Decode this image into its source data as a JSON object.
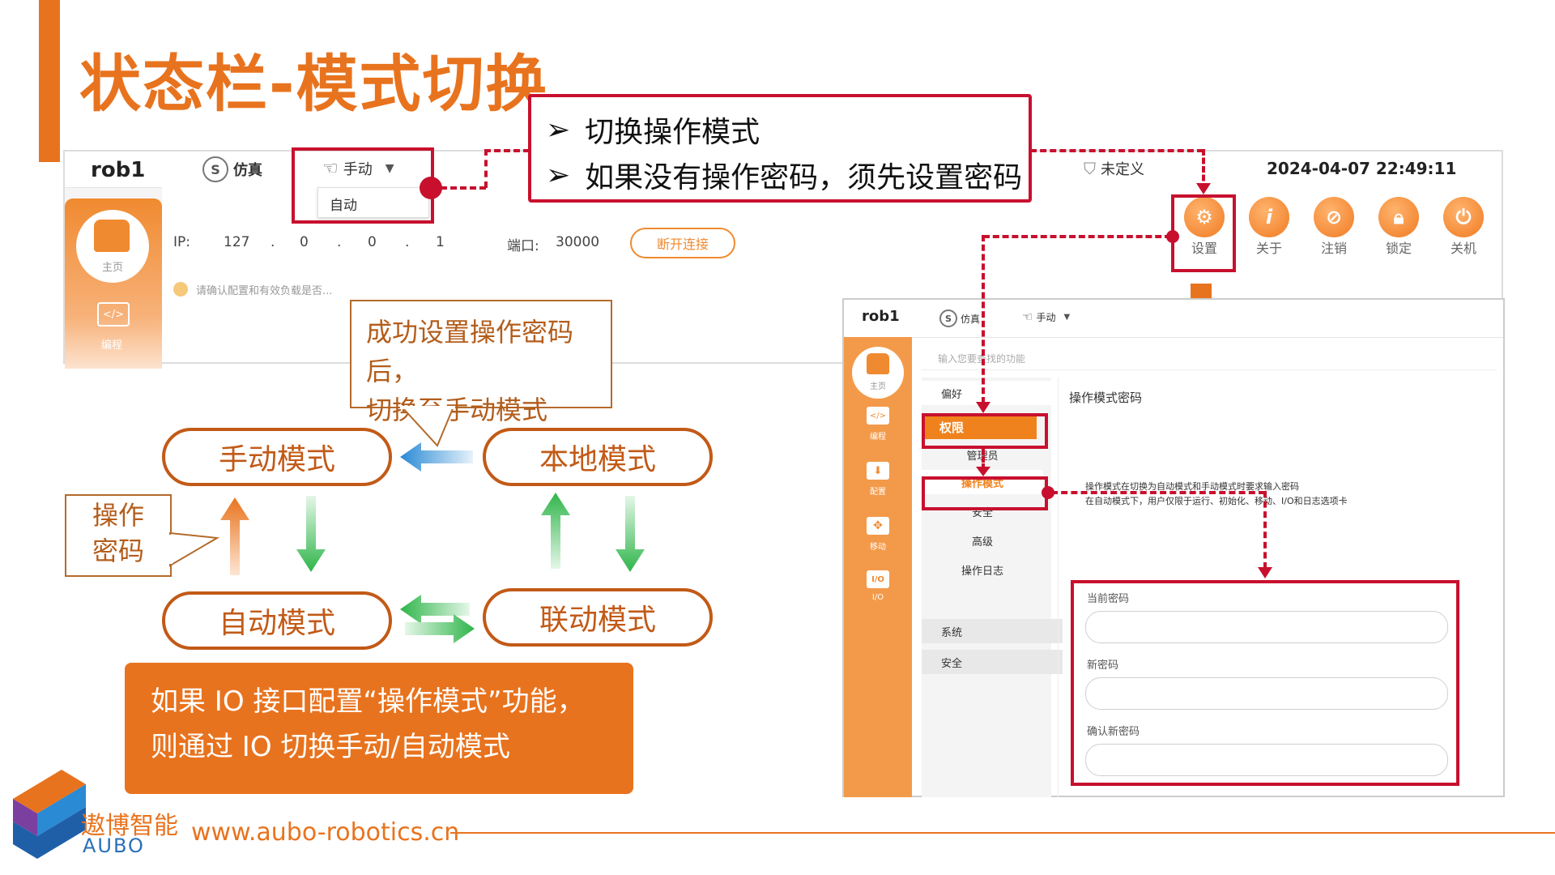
{
  "slide": {
    "title": "状态栏-模式切换"
  },
  "callout": {
    "bullets": [
      "切换操作模式",
      "如果没有操作密码，须先设置密码"
    ],
    "bullet_glyph": "➢"
  },
  "status_bar": {
    "robot_name": "rob1",
    "sim_label": "仿真",
    "mode_label": "手动",
    "mode_dropdown_option": "自动",
    "safety_label": "未定义",
    "datetime": "2024-04-07 22:49:11",
    "ip_label": "IP:",
    "ip_parts": [
      "127",
      "0",
      "0",
      "1"
    ],
    "ip_dot": ".",
    "port_label": "端口:",
    "port_value": "30000",
    "disconnect_button": "断开连接",
    "toolbar": [
      "设置",
      "关于",
      "注销",
      "锁定",
      "关机"
    ],
    "home_label": "主页",
    "program_label": "编程",
    "notice_text": "请确认配置和有效负载是否..."
  },
  "diagram": {
    "speech_note": [
      "成功设置操作密码后，",
      "切换至手动模式"
    ],
    "manual_mode": "手动模式",
    "local_mode": "本地模式",
    "auto_mode": "自动模式",
    "linked_mode": "联动模式",
    "password_note": [
      "操作",
      "密码"
    ],
    "io_note": [
      "如果 IO 接口配置“操作模式”功能，",
      "则通过 IO 切换手动/自动模式"
    ]
  },
  "settings_panel": {
    "robot_name": "rob1",
    "sim_label": "仿真",
    "mode_label": "手动",
    "search_placeholder": "输入您要查找的功能",
    "side_items": [
      "主页",
      "编程",
      "配置",
      "移动",
      "I/O"
    ],
    "menu_items": [
      "偏好",
      "权限",
      "管理员",
      "操作模式",
      "安全",
      "高级",
      "操作日志",
      "系统",
      "安全"
    ],
    "content_title": "操作模式密码",
    "desc_lines": [
      "操作模式在切换为自动模式和手动模式时要求输入密码",
      "在自动模式下，用户仅限于运行、初始化、移动、I/O和日志选项卡"
    ],
    "fields": [
      "当前密码",
      "新密码",
      "确认新密码"
    ]
  },
  "footer": {
    "brand_cn": "遨博智能",
    "brand_en": "AUBO",
    "url": "www.aubo-robotics.cn"
  },
  "colors": {
    "accent": "#e8731e",
    "highlight": "#c8102e",
    "mode_text": "#c25a17"
  }
}
